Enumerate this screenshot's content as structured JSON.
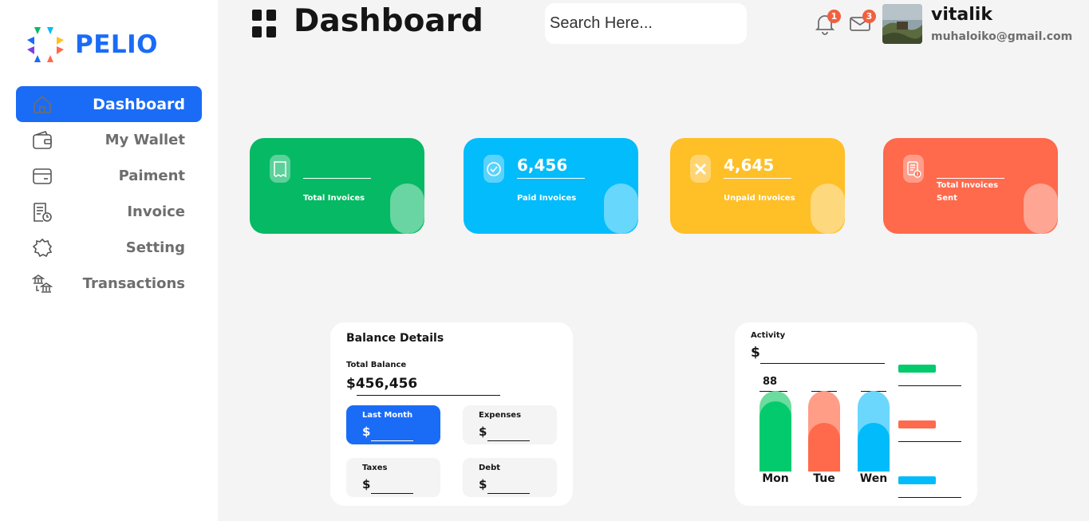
{
  "brand": {
    "name": "PELIO"
  },
  "sidebar": {
    "items": [
      {
        "label": "Dashboard",
        "icon": "home-icon",
        "active": true
      },
      {
        "label": "My Wallet",
        "icon": "wallet-icon",
        "active": false
      },
      {
        "label": "Paiment",
        "icon": "credit-card-icon",
        "active": false
      },
      {
        "label": "Invoice",
        "icon": "invoice-icon",
        "active": false
      },
      {
        "label": "Setting",
        "icon": "gear-icon",
        "active": false
      },
      {
        "label": "Transactions",
        "icon": "bank-transfer-icon",
        "active": false
      }
    ]
  },
  "header": {
    "title": "Dashboard",
    "search_placeholder": "Search Here...",
    "notifications_count": "1",
    "messages_count": "3",
    "user_name": "vitalik",
    "user_email": "muhaloiko@gmail.com"
  },
  "stats": [
    {
      "value": "",
      "label": "Total Invoices",
      "color": "#06b964",
      "icon": "receipt-icon"
    },
    {
      "value": "6,456",
      "label": "Paid Invoices",
      "color": "#03bcfb",
      "icon": "check-circle-icon"
    },
    {
      "value": "4,645",
      "label": "Unpaid Invoices",
      "color": "#febf27",
      "icon": "x-icon"
    },
    {
      "value": "",
      "label": "Total Invoices Sent",
      "color": "#ff694c",
      "icon": "document-dollar-icon"
    }
  ],
  "balance": {
    "title": "Balance Details",
    "total_label": "Total Balance",
    "total_value": "$456,456",
    "boxes": [
      {
        "label": "Last Month",
        "currency": "$"
      },
      {
        "label": "Expenses",
        "currency": "$"
      },
      {
        "label": "Taxes",
        "currency": "$"
      },
      {
        "label": "Debt",
        "currency": "$"
      }
    ]
  },
  "activity": {
    "title": "Activity",
    "currency": "$",
    "top_value": "88",
    "days": [
      {
        "label": "Mon",
        "fill": 0.87,
        "color": "#03cb6d",
        "track": "#6bdc9d"
      },
      {
        "label": "Tue",
        "fill": 0.6,
        "color": "#ff6a4c",
        "track": "#ff9d87"
      },
      {
        "label": "Wen",
        "fill": 0.6,
        "color": "#01bbfa",
        "track": "#6bd7fc"
      }
    ],
    "legend_colors": [
      "#03cb6d",
      "#ff6a4c",
      "#01bbfa"
    ]
  },
  "colors": {
    "accent": "#1a6cf6",
    "background": "#f4f4f4",
    "badge": "#f06040"
  }
}
